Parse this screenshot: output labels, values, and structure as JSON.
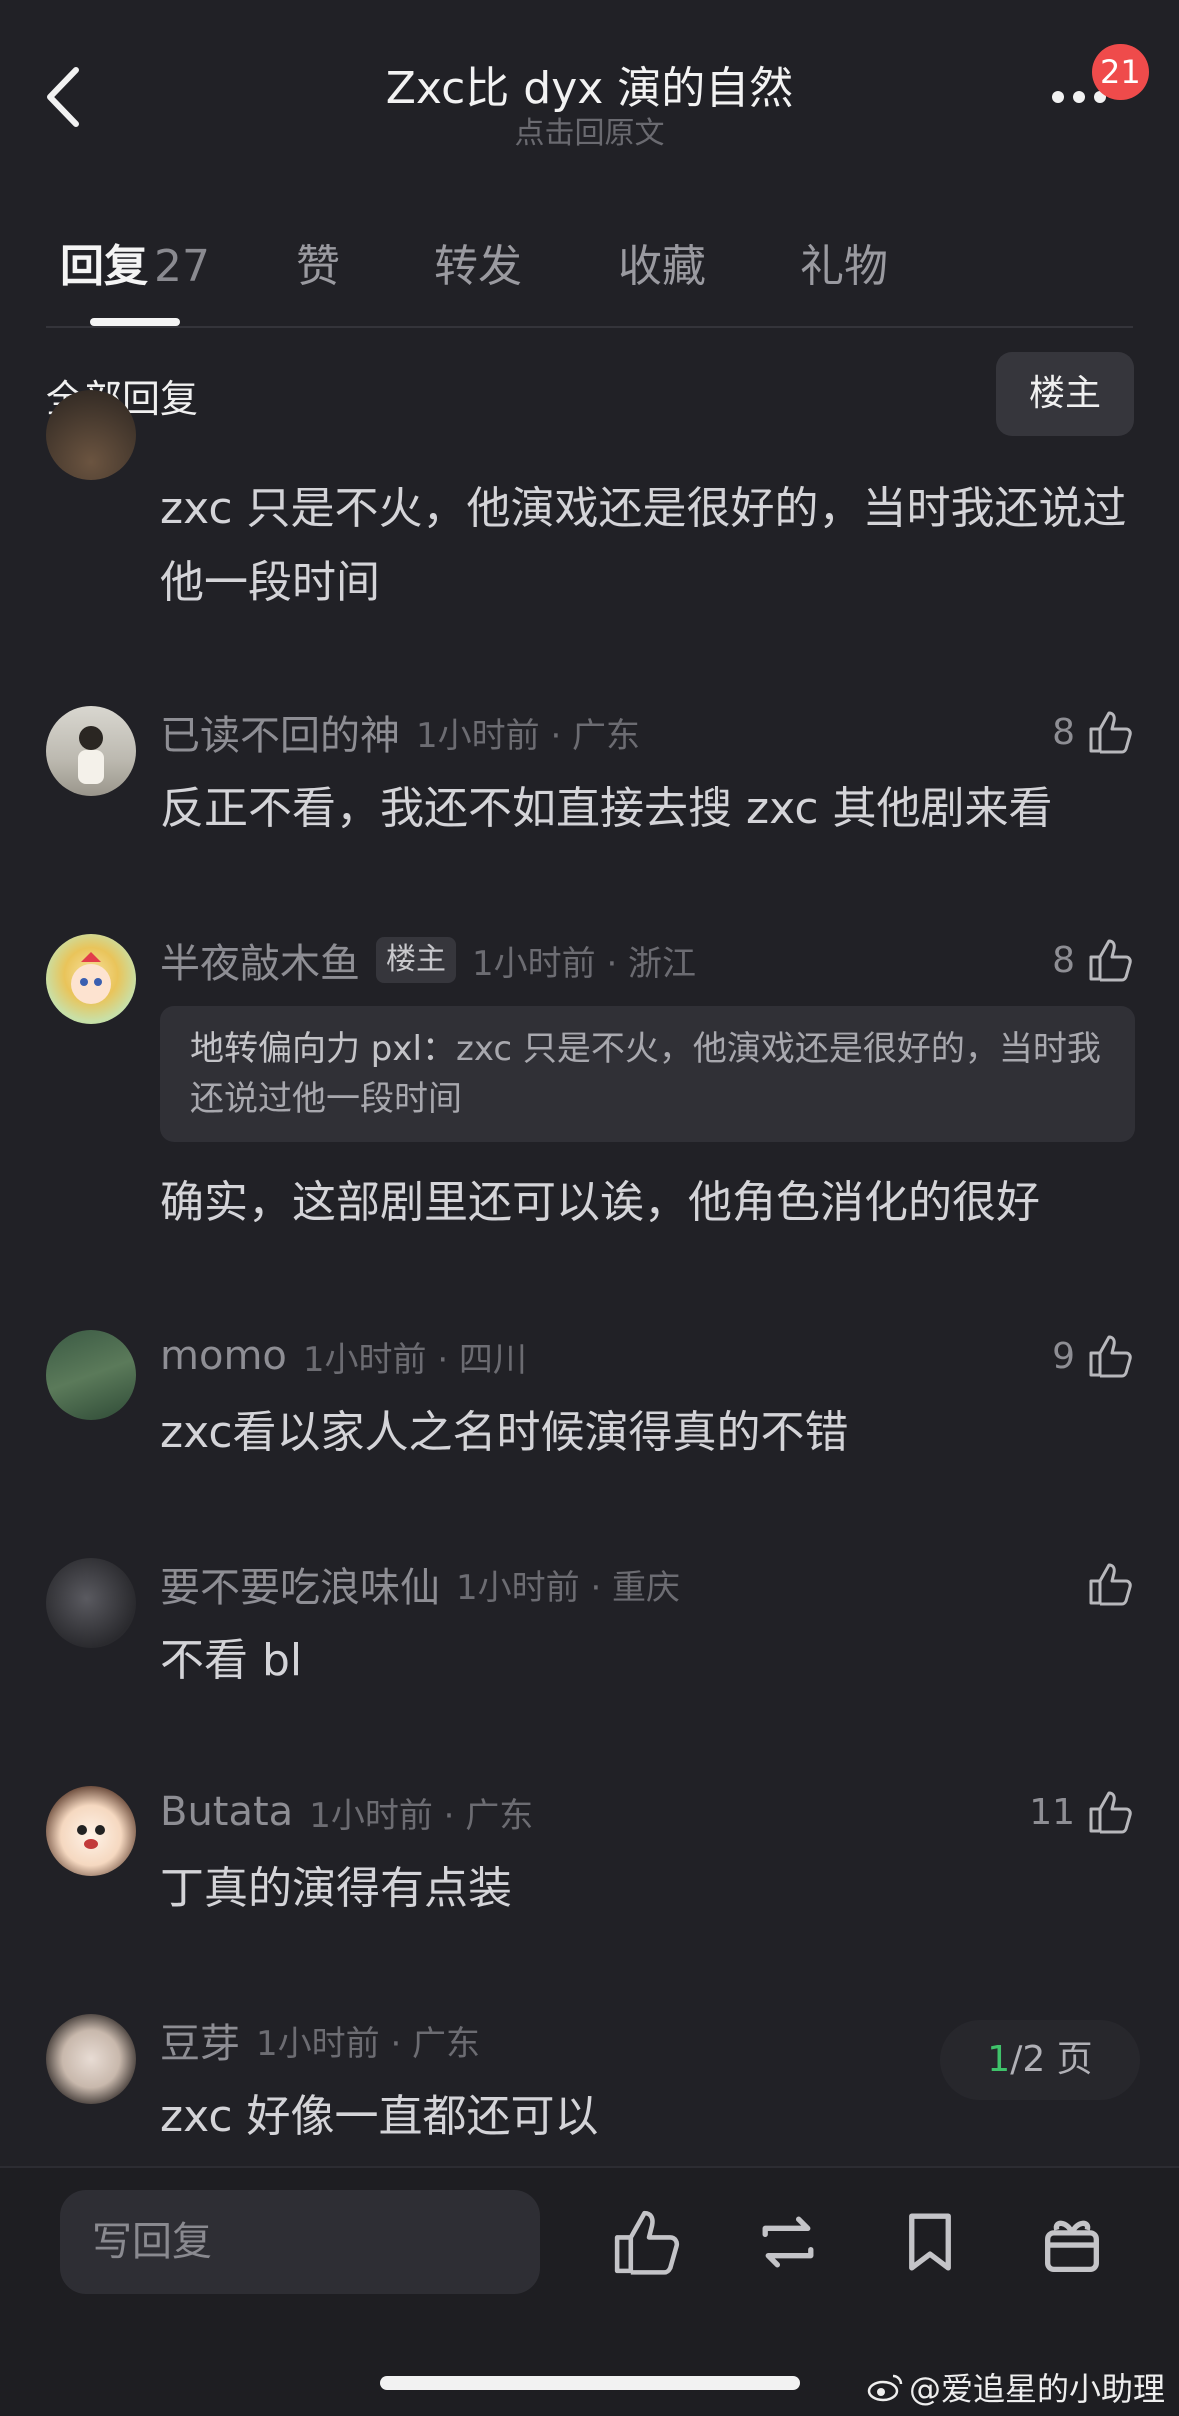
{
  "header": {
    "title": "Zxc比 dyx 演的自然",
    "subtitle": "点击回原文",
    "badge": "21"
  },
  "tabs": [
    {
      "label": "回复",
      "count": "27"
    },
    {
      "label": "赞"
    },
    {
      "label": "转发"
    },
    {
      "label": "收藏"
    },
    {
      "label": "礼物"
    }
  ],
  "section": {
    "title": "全部回复",
    "filter": "楼主"
  },
  "comments": [
    {
      "body": "zxc 只是不火，他演戏还是很好的，当时我还说过他一段时间"
    },
    {
      "name": "已读不回的神",
      "time": "1小时前 · 广东",
      "likes": "8",
      "body": "反正不看，我还不如直接去搜 zxc 其他剧来看"
    },
    {
      "name": "半夜敲木鱼",
      "tag": "楼主",
      "time": "1小时前 · 浙江",
      "likes": "8",
      "quote_name": "地转偏向力 pxl：",
      "quote_text": "zxc 只是不火，他演戏还是很好的，当时我还说过他一段时间",
      "body": "确实，这部剧里还可以诶，他角色消化的很好"
    },
    {
      "name": "momo",
      "time": "1小时前 · 四川",
      "likes": "9",
      "body": "zxc看以家人之名时候演得真的不错"
    },
    {
      "name": "要不要吃浪味仙",
      "time": "1小时前 · 重庆",
      "likes": "",
      "body": "不看 bl"
    },
    {
      "name": "Butata",
      "time": "1小时前 · 广东",
      "likes": "11",
      "body": "丁真的演得有点装"
    },
    {
      "name": "豆芽",
      "time": "1小时前 · 广东",
      "body": "zxc 好像一直都还可以"
    }
  ],
  "pager": {
    "current": "1",
    "rest": "/2 页"
  },
  "bottom": {
    "reply_placeholder": "写回复"
  },
  "watermark": "@爱追星的小助理",
  "colors": {
    "background": "#212126",
    "badge": "#ef4b4b",
    "pager_current": "#3fc26a"
  }
}
